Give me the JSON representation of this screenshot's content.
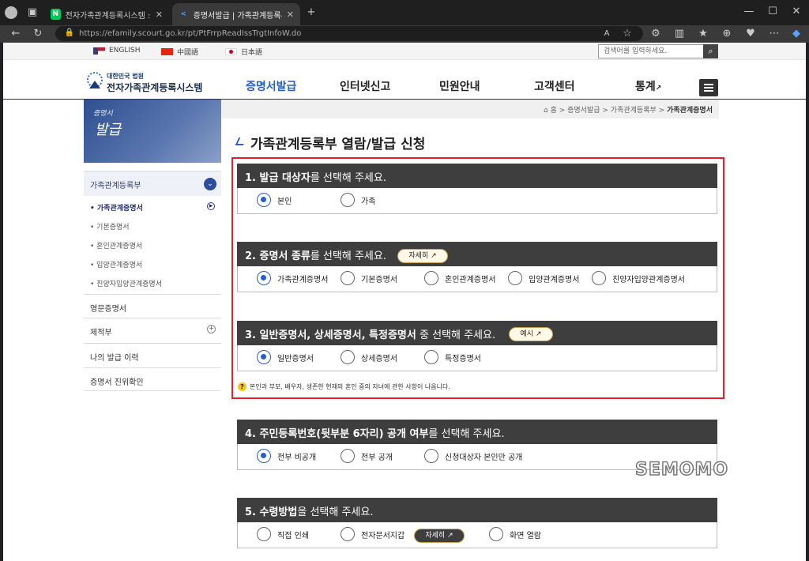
{
  "browser": {
    "tabs": [
      {
        "label": "전자가족관계등록시스템 : 네이버",
        "favicon": "N"
      },
      {
        "label": "증명서발급 | 가족관계등록부 | 가",
        "favicon": "<"
      }
    ],
    "url": "https://efamily.scourt.go.kr/pt/PtFrrpReadIssTrgtInfoW.do"
  },
  "util": {
    "langs": [
      {
        "label": "ENGLISH",
        "flag": "us"
      },
      {
        "label": "中國語",
        "flag": "cn"
      },
      {
        "label": "日本語",
        "flag": "jp"
      }
    ],
    "search_placeholder": "검색어를 입력하세요."
  },
  "header": {
    "logo_small": "대한민국 법원",
    "logo_big": "전자가족관계등록시스템",
    "nav": [
      "증명서발급",
      "인터넷신고",
      "민원안내",
      "고객센터",
      "통계"
    ]
  },
  "sidebar": {
    "banner_t1": "증명서",
    "banner_t2": "발급",
    "group_label": "가족관계등록부",
    "sub_items": [
      "• 가족관계증명서",
      "• 기본증명서",
      "• 혼인관계증명서",
      "• 입양관계증명서",
      "• 친양자입양관계증명서"
    ],
    "items": [
      "영문증명서",
      "제적부",
      "나의 발급 이력",
      "증명서 진위확인"
    ]
  },
  "breadcrumb": {
    "home": "홈",
    "path": [
      "증명서발급",
      "가족관계등록부"
    ],
    "current": "가족관계증명서"
  },
  "page_title": "가족관계등록부 열람/발급 신청",
  "sections": [
    {
      "bold": "1. 발급 대상자",
      "rest": "를 선택해 주세요.",
      "options": [
        "본인",
        "가족"
      ]
    },
    {
      "bold": "2. 증명서 종류",
      "rest": "를 선택해 주세요.",
      "button": "자세히",
      "options": [
        "가족관계증명서",
        "기본증명서",
        "혼인관계증명서",
        "입양관계증명서",
        "친양자입양관계증명서"
      ]
    },
    {
      "bold": "3. 일반증명서, 상세증명서, 특정증명서",
      "rest": " 중 선택해 주세요.",
      "button": "예시",
      "options": [
        "일반증명서",
        "상세증명서",
        "특정증명서"
      ]
    },
    {
      "bold": "4. 주민등록번호(뒷부분 6자리) 공개 여부",
      "rest": "를 선택해 주세요.",
      "options": [
        "전부 비공개",
        "전부 공개",
        "신청대상자 본인만 공개"
      ]
    },
    {
      "bold": "5. 수령방법",
      "rest": "을 선택해 주세요.",
      "button": "자세히",
      "options": [
        "직접 인쇄",
        "전자문서지갑",
        "화면 열람"
      ]
    }
  ],
  "note": "본인과 부모, 배우자, 생존한 현재의 혼인 중의 자녀에 관한 사항이 나옵니다.",
  "watermark": "SEMOMO",
  "colors": {
    "accent": "#2a5ec4",
    "highlight_box": "#e0202a",
    "section_header": "#3e3e3e"
  }
}
